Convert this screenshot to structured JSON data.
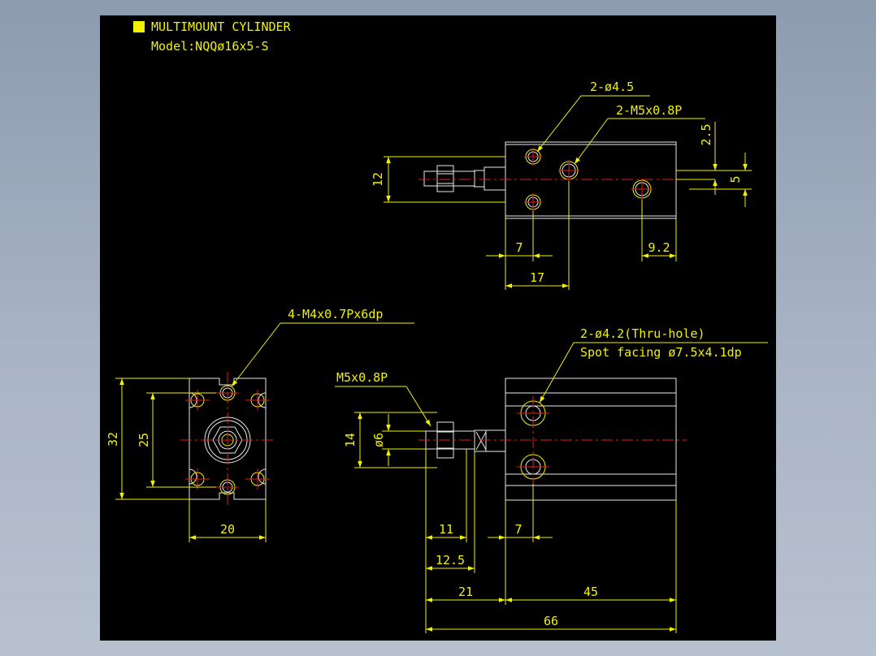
{
  "title": {
    "line1": "MULTIMOUNT CYLINDER",
    "line2": "Model:NQQø16x5-S",
    "marker_color": "#f2f200"
  },
  "colors": {
    "background": "#000000",
    "outline": "#e8e8e8",
    "dimension": "#f2f200",
    "centerline": "#e21b1b",
    "frame": "#a9b4c5"
  },
  "top_view": {
    "callout_holes": "2-ø4.5",
    "callout_thread": "2-M5x0.8P",
    "dim_height": "12",
    "dim_offset_top": "2.5",
    "dim_offset": "5",
    "dim_hole_x": "7",
    "dim_thread_x": "17",
    "dim_right_hole": "9.2"
  },
  "end_view": {
    "callout_threads": "4-M4x0.7Px6dp",
    "dim_height": "32",
    "dim_pitch": "25",
    "dim_width": "20"
  },
  "side_view": {
    "callout_holes_1": "2-ø4.2(Thru-hole)",
    "callout_holes_2": "Spot facing ø7.5x4.1dp",
    "callout_rod_thread": "M5x0.8P",
    "dim_rod_height": "14",
    "dim_rod_dia": "ø6",
    "dim_11": "11",
    "dim_7": "7",
    "dim_12_5": "12.5",
    "dim_21": "21",
    "dim_45": "45",
    "dim_66": "66"
  }
}
